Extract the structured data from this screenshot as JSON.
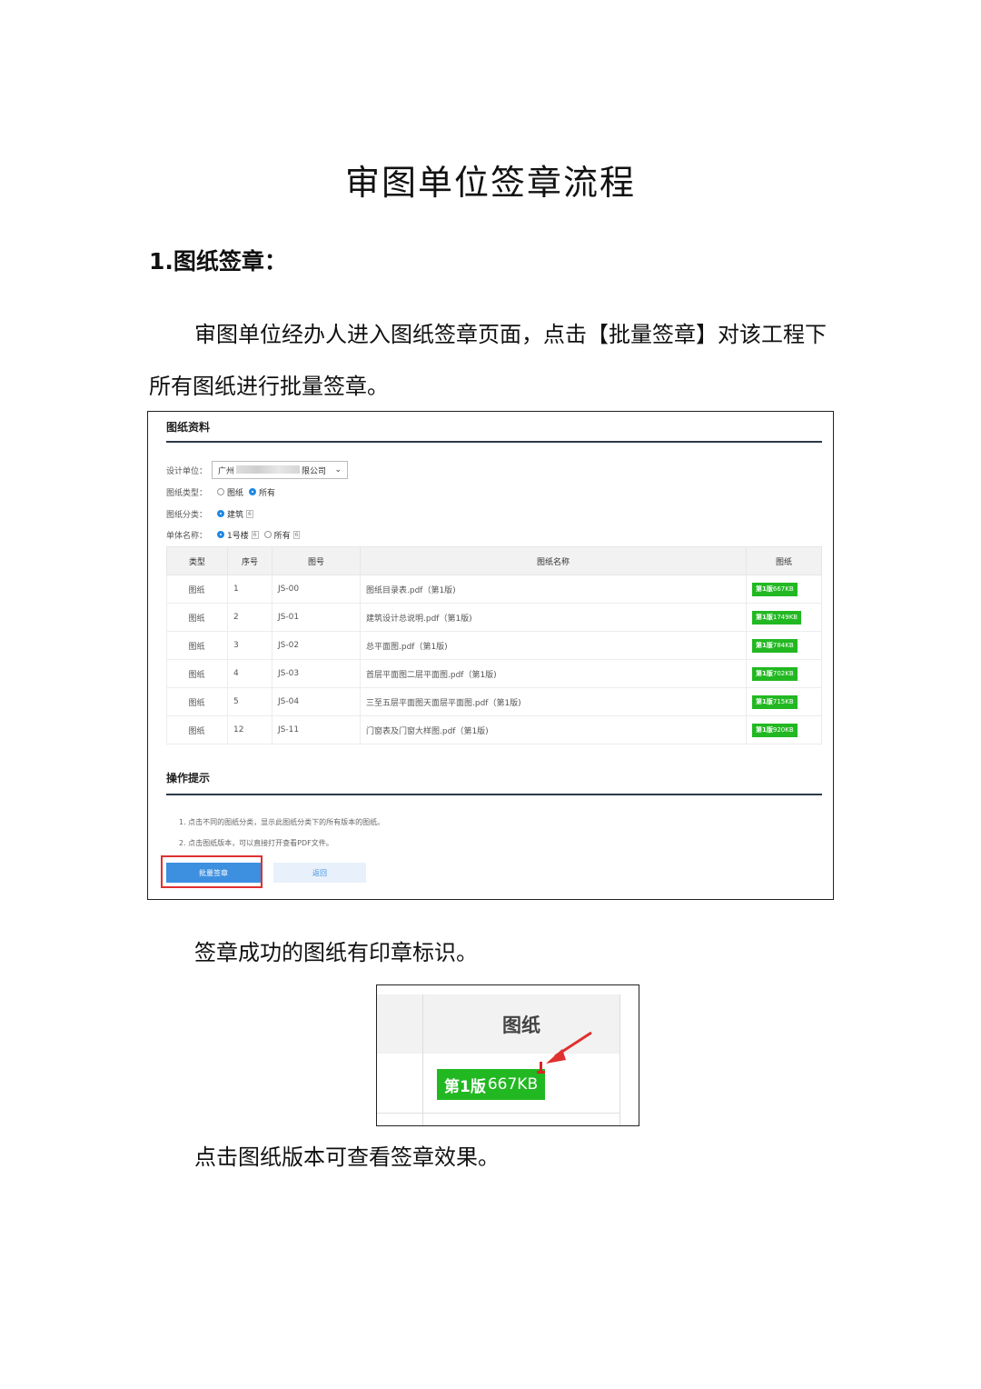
{
  "doc": {
    "title": "审图单位签章流程",
    "section1_heading": "1.图纸签章：",
    "para1": "审图单位经办人进入图纸签章页面，点击【批量签章】对该工程下所有图纸进行批量签章。",
    "para2": "签章成功的图纸有印章标识。",
    "para3": "点击图纸版本可查看签章效果。"
  },
  "screenshot1": {
    "panel_title": "图纸资料",
    "design_unit_label": "设计单位：",
    "design_unit_prefix": "广州",
    "design_unit_suffix": "限公司",
    "drawing_type_label": "图纸类型：",
    "drawing_type_opt1": "图纸",
    "drawing_type_opt2": "所有",
    "category_label": "图纸分类：",
    "category_opt1": "建筑",
    "category_opt1_count": "6",
    "unit_name_label": "单体名称：",
    "unit_opt1": "1号楼",
    "unit_opt1_count": "6",
    "unit_opt2": "所有",
    "unit_opt2_count": "6",
    "columns": [
      "类型",
      "序号",
      "图号",
      "图纸名称",
      "图纸"
    ],
    "rows": [
      {
        "type": "图纸",
        "seq": "1",
        "code": "JS-00",
        "name": "图纸目录表.pdf（第1版)",
        "ver": "第1版",
        "size": "667KB"
      },
      {
        "type": "图纸",
        "seq": "2",
        "code": "JS-01",
        "name": "建筑设计总说明.pdf（第1版)",
        "ver": "第1版",
        "size": "1749KB"
      },
      {
        "type": "图纸",
        "seq": "3",
        "code": "JS-02",
        "name": "总平面图.pdf（第1版)",
        "ver": "第1版",
        "size": "784KB"
      },
      {
        "type": "图纸",
        "seq": "4",
        "code": "JS-03",
        "name": "首层平面图二层平面图.pdf（第1版)",
        "ver": "第1版",
        "size": "702KB"
      },
      {
        "type": "图纸",
        "seq": "5",
        "code": "JS-04",
        "name": "三至五层平面图天面层平面图.pdf（第1版)",
        "ver": "第1版",
        "size": "715KB"
      },
      {
        "type": "图纸",
        "seq": "12",
        "code": "JS-11",
        "name": "门窗表及门窗大样图.pdf（第1版)",
        "ver": "第1版",
        "size": "920KB"
      }
    ],
    "tips_title": "操作提示",
    "tip1": "1. 点击不同的图纸分类，显示此图纸分类下的所有版本的图纸。",
    "tip2": "2. 点击图纸版本，可以直接打开查看PDF文件。",
    "batch_button": "批量签章",
    "back_button": "返回",
    "colors": {
      "accent": "#3d8fe0",
      "version_badge": "#22b822",
      "highlight": "#e03030"
    }
  },
  "screenshot2": {
    "column_header": "图纸",
    "ver": "第1版",
    "size": "667KB"
  }
}
